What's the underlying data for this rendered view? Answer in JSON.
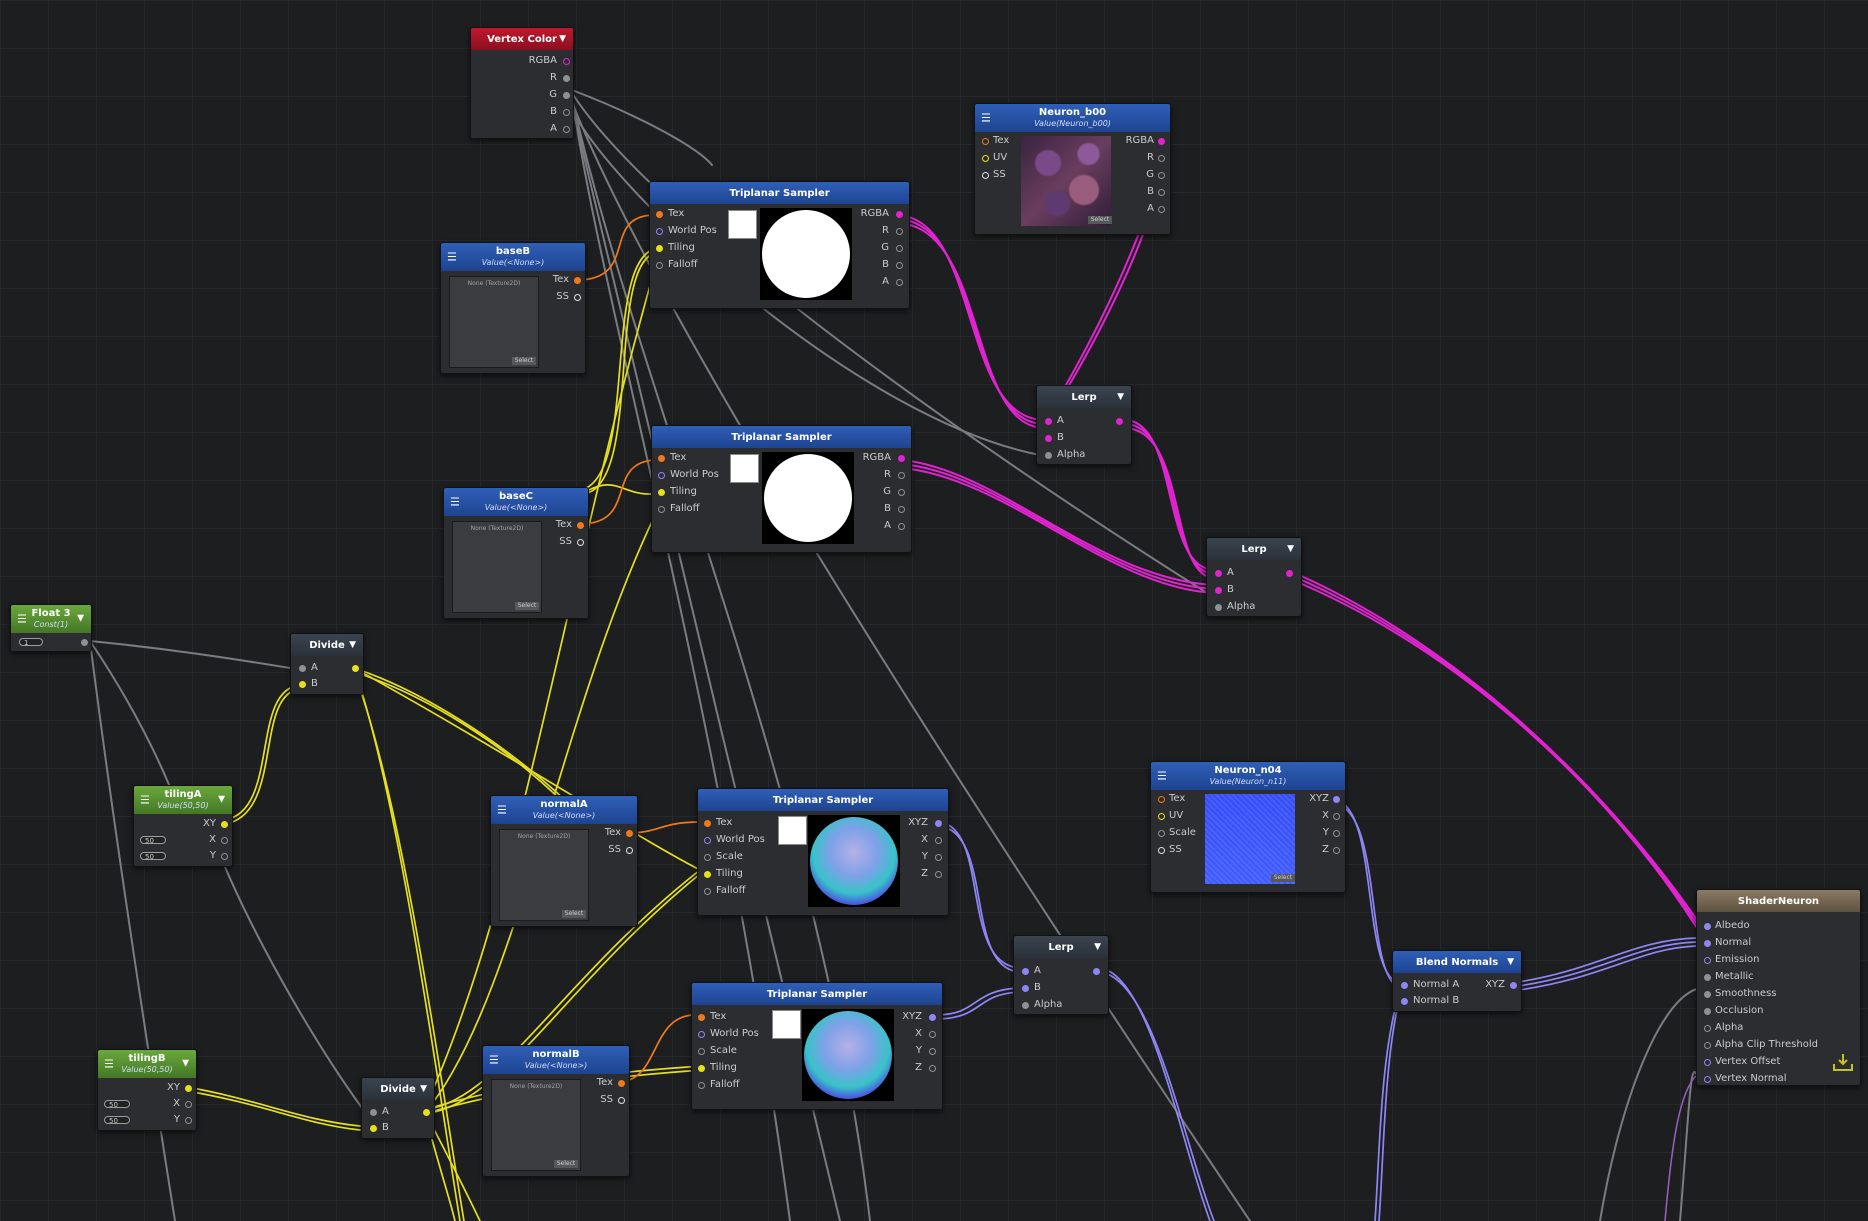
{
  "nodes": {
    "vertex_color": {
      "title": "Vertex Color",
      "outputs": [
        "RGBA",
        "R",
        "G",
        "B",
        "A"
      ]
    },
    "neuron_b00": {
      "title": "Neuron_b00",
      "sub": "Value(Neuron_b00)",
      "inputs": [
        "Tex",
        "UV",
        "SS"
      ],
      "outputs": [
        "RGBA",
        "R",
        "G",
        "B",
        "A"
      ],
      "select": "Select"
    },
    "triplanar1": {
      "title": "Triplanar Sampler",
      "inputs": [
        "Tex",
        "World Pos",
        "Tiling",
        "Falloff"
      ],
      "outputs": [
        "RGBA",
        "R",
        "G",
        "B",
        "A"
      ]
    },
    "triplanar2": {
      "title": "Triplanar Sampler",
      "inputs": [
        "Tex",
        "World Pos",
        "Tiling",
        "Falloff"
      ],
      "outputs": [
        "RGBA",
        "R",
        "G",
        "B",
        "A"
      ]
    },
    "triplanar3": {
      "title": "Triplanar Sampler",
      "inputs": [
        "Tex",
        "World Pos",
        "Scale",
        "Tiling",
        "Falloff"
      ],
      "outputs": [
        "XYZ",
        "X",
        "Y",
        "Z"
      ]
    },
    "triplanar4": {
      "title": "Triplanar Sampler",
      "inputs": [
        "Tex",
        "World Pos",
        "Scale",
        "Tiling",
        "Falloff"
      ],
      "outputs": [
        "XYZ",
        "X",
        "Y",
        "Z"
      ]
    },
    "baseB": {
      "title": "baseB",
      "sub": "Value(<None>)",
      "tex_label": "None (Texture2D)",
      "outputs": [
        "Tex",
        "SS"
      ],
      "select": "Select"
    },
    "baseC": {
      "title": "baseC",
      "sub": "Value(<None>)",
      "tex_label": "None (Texture2D)",
      "outputs": [
        "Tex",
        "SS"
      ],
      "select": "Select"
    },
    "normalA": {
      "title": "normalA",
      "sub": "Value(<None>)",
      "tex_label": "None (Texture2D)",
      "outputs": [
        "Tex",
        "SS"
      ],
      "select": "Select"
    },
    "normalB": {
      "title": "normalB",
      "sub": "Value(<None>)",
      "tex_label": "None (Texture2D)",
      "outputs": [
        "Tex",
        "SS"
      ],
      "select": "Select"
    },
    "lerp1": {
      "title": "Lerp",
      "inputs": [
        "A",
        "B",
        "Alpha"
      ]
    },
    "lerp2": {
      "title": "Lerp",
      "inputs": [
        "A",
        "B",
        "Alpha"
      ]
    },
    "lerp3": {
      "title": "Lerp",
      "inputs": [
        "A",
        "B",
        "Alpha"
      ]
    },
    "float3": {
      "title": "Float 3",
      "sub": "Const(1)",
      "value": "1"
    },
    "divide1": {
      "title": "Divide",
      "inputs": [
        "A",
        "B"
      ]
    },
    "divide2": {
      "title": "Divide",
      "inputs": [
        "A",
        "B"
      ]
    },
    "tilingA": {
      "title": "tilingA",
      "sub": "Value(50,50)",
      "outputs": [
        "XY",
        "X",
        "Y"
      ],
      "x_val": "50",
      "y_val": "50"
    },
    "tilingB": {
      "title": "tilingB",
      "sub": "Value(50,50)",
      "outputs": [
        "XY",
        "X",
        "Y"
      ],
      "x_val": "50",
      "y_val": "50"
    },
    "neuron_n04": {
      "title": "Neuron_n04",
      "sub": "Value(Neuron_n11)",
      "inputs": [
        "Tex",
        "UV",
        "Scale",
        "SS"
      ],
      "outputs": [
        "XYZ",
        "X",
        "Y",
        "Z"
      ],
      "select": "Select"
    },
    "blend_normals": {
      "title": "Blend Normals",
      "inputs": [
        "Normal A",
        "Normal B"
      ],
      "output": "XYZ"
    },
    "shader_neuron": {
      "title": "ShaderNeuron",
      "inputs": [
        "Albedo",
        "Normal",
        "Emission",
        "Metallic",
        "Smoothness",
        "Occlusion",
        "Alpha",
        "Alpha Clip Threshold",
        "Vertex Offset",
        "Vertex Normal"
      ]
    }
  },
  "colors": {
    "magenta": "#e223d2",
    "yellow": "#e5df1e",
    "orange": "#f07a1b",
    "purple": "#8f86f5",
    "gray": "#8d9196"
  }
}
